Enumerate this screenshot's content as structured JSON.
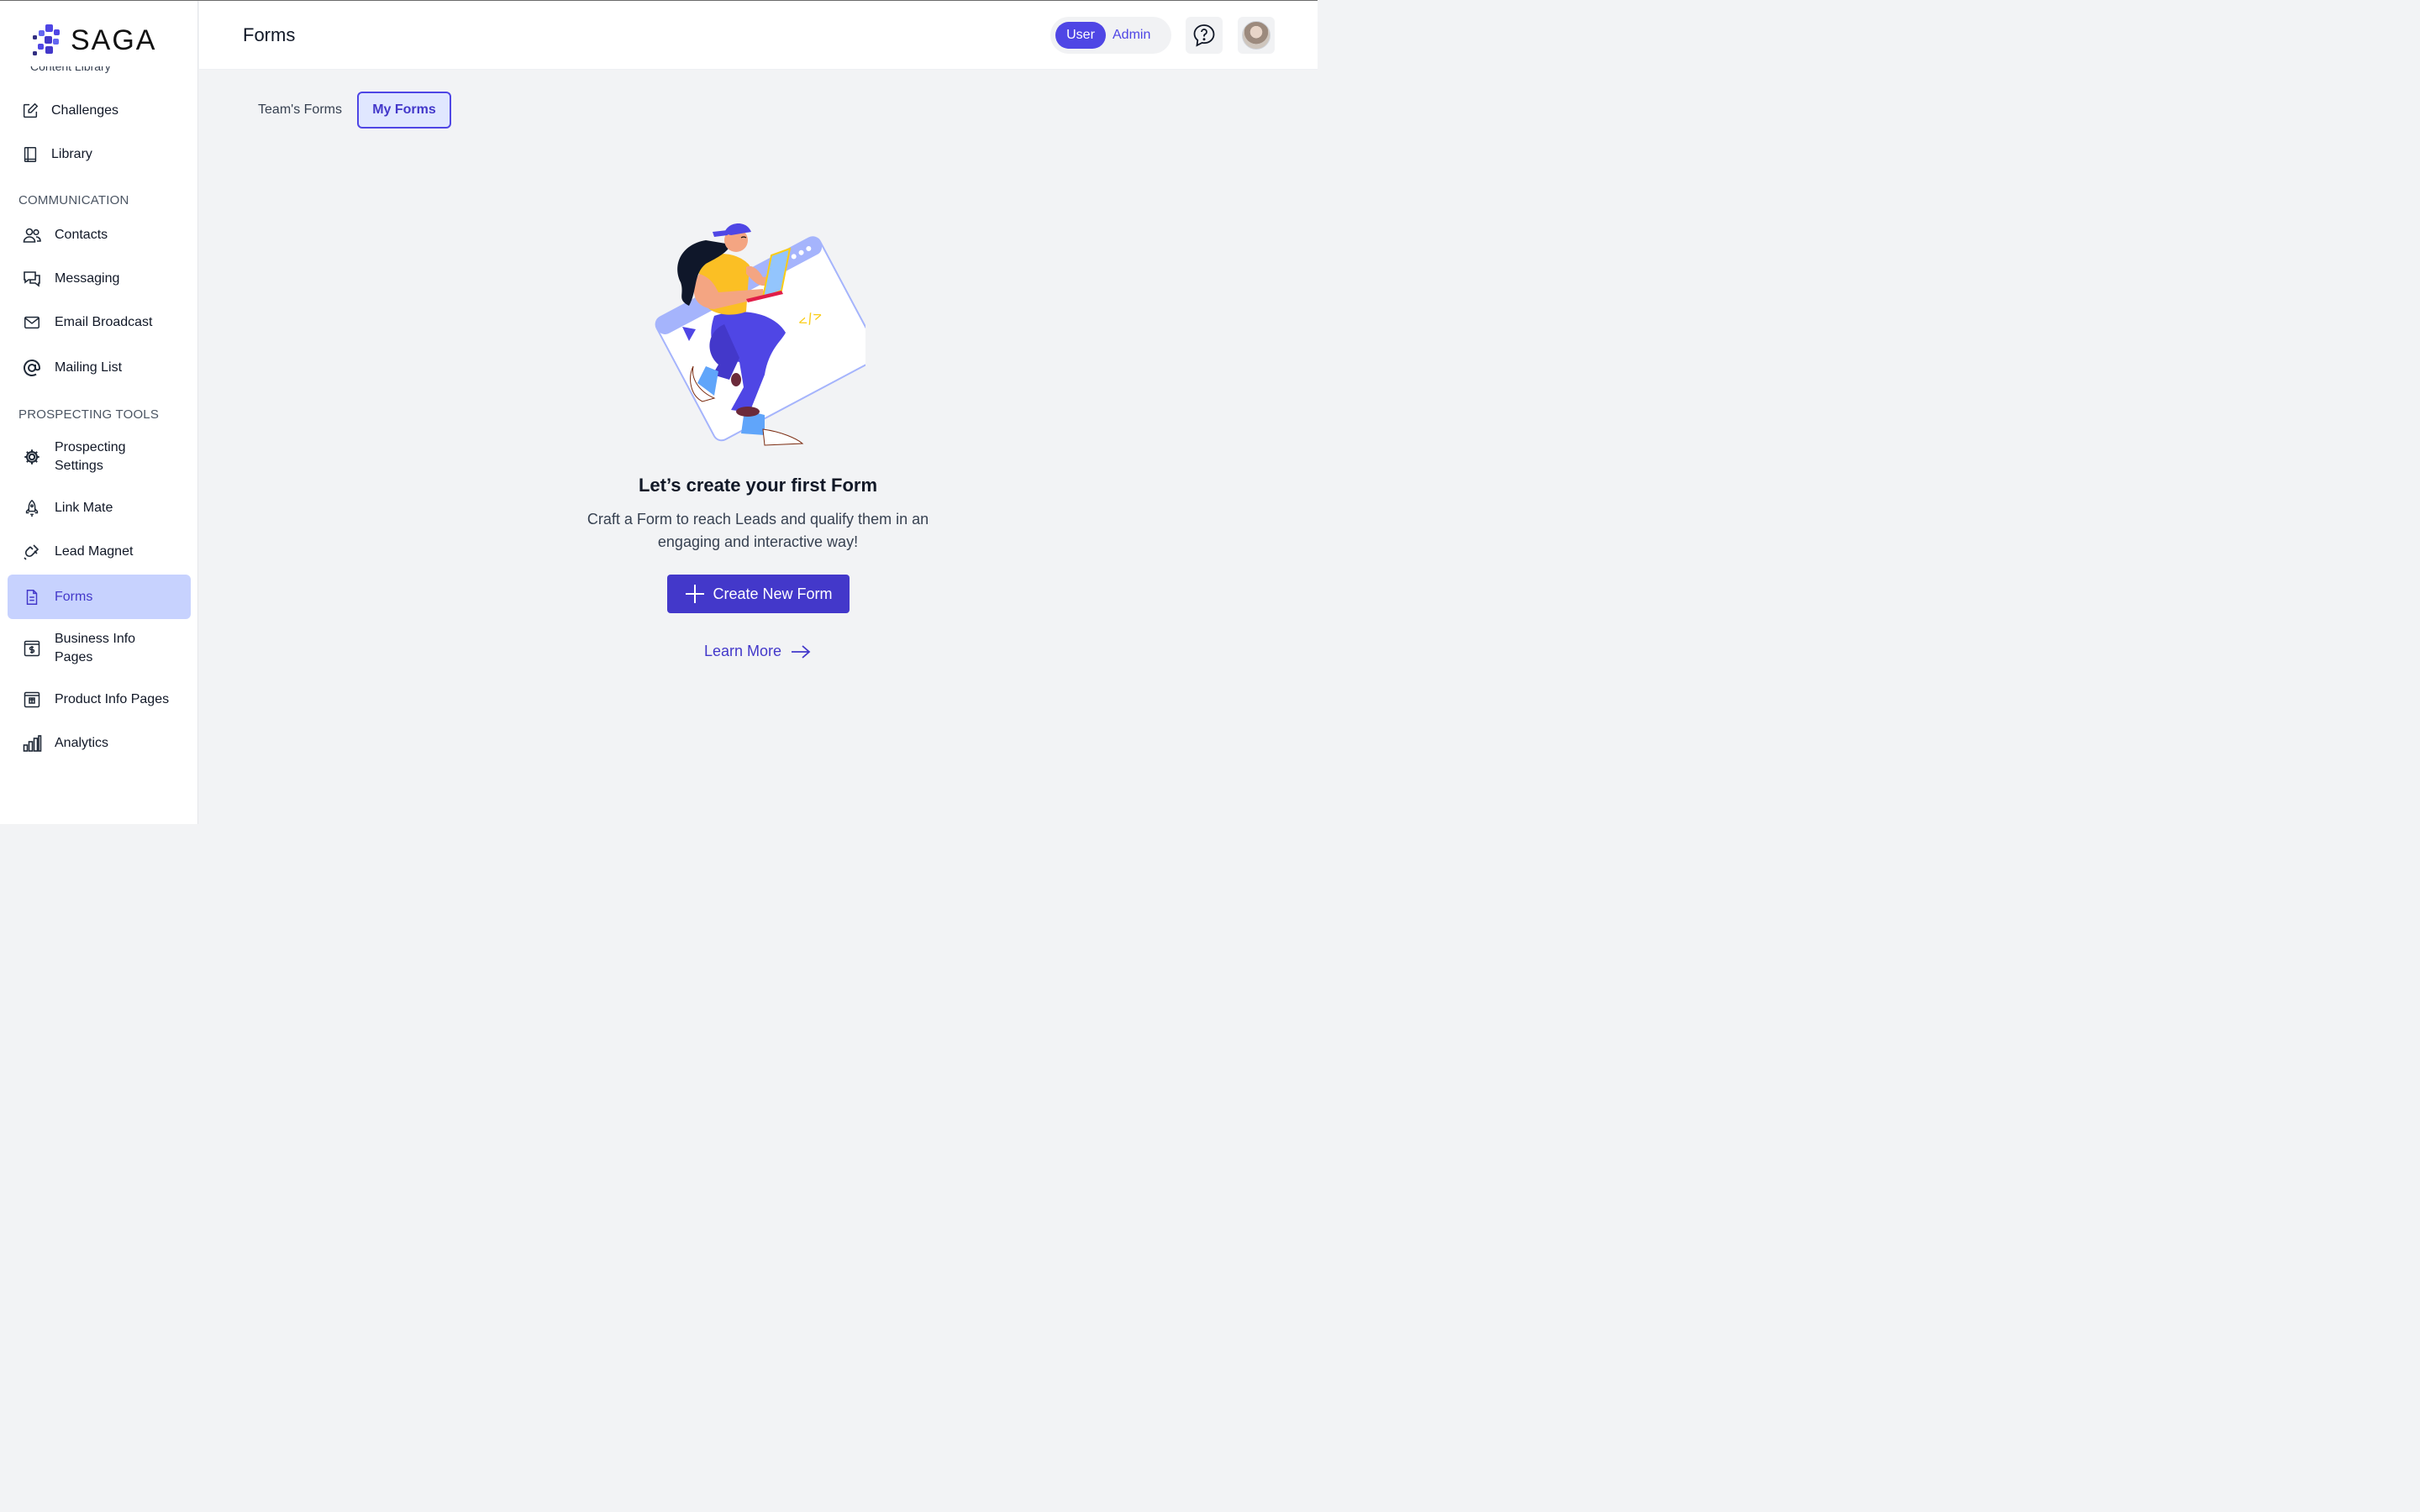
{
  "brand": {
    "name": "SAGA",
    "partial_item": "Content Library"
  },
  "sidebar": {
    "top_items": [
      {
        "label": "Challenges",
        "icon": "edit-square-icon"
      },
      {
        "label": "Library",
        "icon": "book-icon"
      }
    ],
    "sections": [
      {
        "title": "COMMUNICATION",
        "items": [
          {
            "label": "Contacts",
            "icon": "users-icon"
          },
          {
            "label": "Messaging",
            "icon": "chat-bubbles-icon"
          },
          {
            "label": "Email Broadcast",
            "icon": "envelope-icon"
          },
          {
            "label": "Mailing List",
            "icon": "at-sign-icon"
          }
        ]
      },
      {
        "title": "PROSPECTING TOOLS",
        "items": [
          {
            "label": "Prospecting Settings",
            "icon": "gear-icon"
          },
          {
            "label": "Link Mate",
            "icon": "rocket-icon"
          },
          {
            "label": "Lead Magnet",
            "icon": "magnet-icon"
          },
          {
            "label": "Forms",
            "icon": "document-icon",
            "active": true
          },
          {
            "label": "Business Info Pages",
            "icon": "dollar-page-icon"
          },
          {
            "label": "Product Info Pages",
            "icon": "product-page-icon"
          },
          {
            "label": "Analytics",
            "icon": "bar-chart-icon"
          }
        ]
      }
    ]
  },
  "header": {
    "title": "Forms",
    "role_toggle": {
      "user": "User",
      "admin": "Admin",
      "selected": "User"
    }
  },
  "tabs": [
    {
      "label": "Team's Forms",
      "active": false
    },
    {
      "label": "My Forms",
      "active": true
    }
  ],
  "empty_state": {
    "title": "Let’s create your first Form",
    "description": "Craft a Form to reach Leads and qualify them in an engaging and interactive way!",
    "primary_button": "Create New Form",
    "link": "Learn More"
  },
  "colors": {
    "accent": "#4338ca",
    "accent_light": "#c7d2fe",
    "background": "#f2f3f5"
  }
}
